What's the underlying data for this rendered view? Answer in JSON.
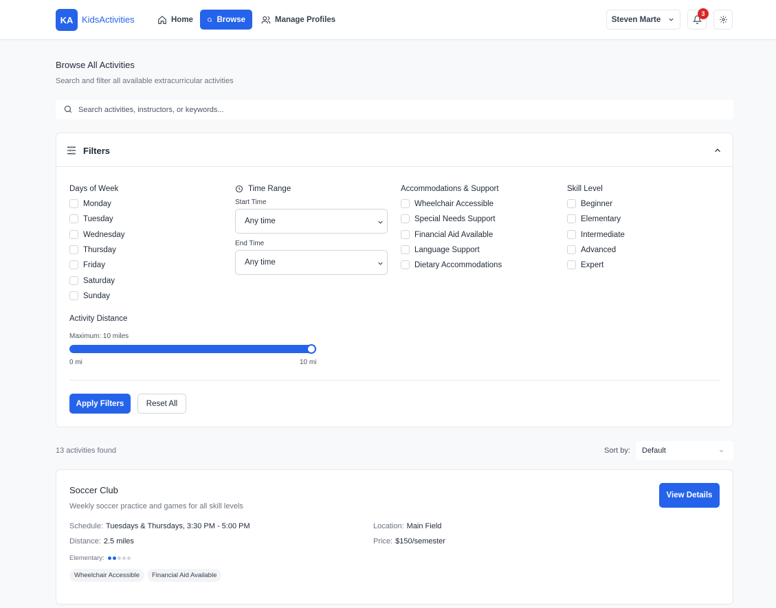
{
  "header": {
    "logo_initials": "KA",
    "app_name": "KidsActivities",
    "nav": {
      "home": "Home",
      "browse": "Browse",
      "profiles": "Manage Profiles"
    },
    "user_name": "Steven Marte",
    "notifications_count": "3"
  },
  "page": {
    "title": "Browse All Activities",
    "subtitle": "Search and filter all available extracurricular activities",
    "search_placeholder": "Search activities, instructors, or keywords..."
  },
  "filters": {
    "title": "Filters",
    "days": {
      "heading": "Days of Week",
      "items": [
        "Monday",
        "Tuesday",
        "Wednesday",
        "Thursday",
        "Friday",
        "Saturday",
        "Sunday"
      ]
    },
    "time": {
      "heading": "Time Range",
      "start_label": "Start Time",
      "start_value": "Any time",
      "end_label": "End Time",
      "end_value": "Any time"
    },
    "accommodations": {
      "heading": "Accommodations & Support",
      "items": [
        "Wheelchair Accessible",
        "Special Needs Support",
        "Financial Aid Available",
        "Language Support",
        "Dietary Accommodations"
      ]
    },
    "skill": {
      "heading": "Skill Level",
      "items": [
        "Beginner",
        "Elementary",
        "Intermediate",
        "Advanced",
        "Expert"
      ]
    },
    "distance": {
      "heading": "Activity Distance",
      "max_label": "Maximum: 10 miles",
      "min_tick": "0 mi",
      "max_tick": "10 mi",
      "value_fraction": 1.0
    },
    "apply_label": "Apply Filters",
    "reset_label": "Reset All"
  },
  "results": {
    "count_text": "13 activities found",
    "sort_label": "Sort by:",
    "sort_value": "Default",
    "activity": {
      "name": "Soccer Club",
      "description": "Weekly soccer practice and games for all skill levels",
      "view_label": "View Details",
      "schedule_label": "Schedule:",
      "schedule_value": "Tuesdays & Thursdays, 3:30 PM - 5:00 PM",
      "location_label": "Location:",
      "location_value": "Main Field",
      "distance_label": "Distance:",
      "distance_value": "2.5 miles",
      "price_label": "Price:",
      "price_value": "$150/semester",
      "skill_label": "Elementary:",
      "skill_level": 2,
      "skill_max": 5,
      "tags": [
        "Wheelchair Accessible",
        "Financial Aid Available"
      ]
    }
  },
  "colors": {
    "accent": "#2563eb",
    "badge": "#dc2626"
  }
}
